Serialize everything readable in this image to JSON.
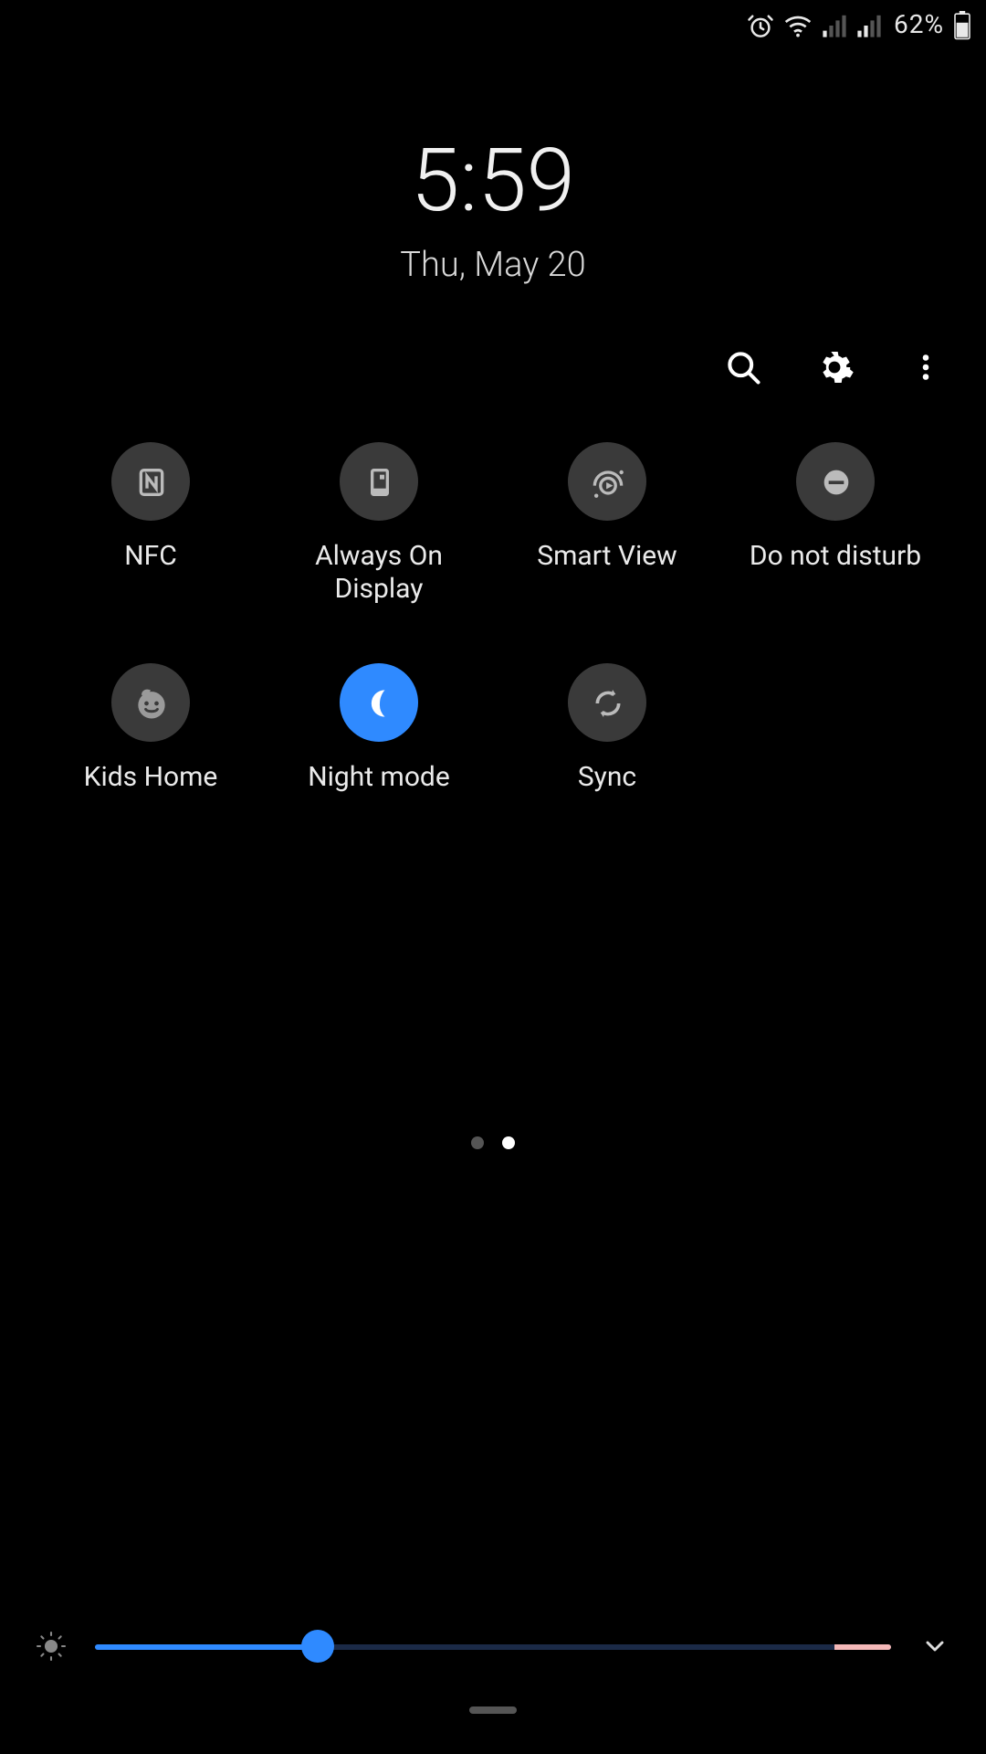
{
  "status": {
    "battery_text": "62%"
  },
  "clock": {
    "time": "5:59",
    "date": "Thu, May 20"
  },
  "tiles": [
    {
      "id": "nfc",
      "label": "NFC",
      "active": false
    },
    {
      "id": "aod",
      "label": "Always On Display",
      "active": false
    },
    {
      "id": "smartview",
      "label": "Smart View",
      "active": false
    },
    {
      "id": "dnd",
      "label": "Do not disturb",
      "active": false
    },
    {
      "id": "kidshome",
      "label": "Kids Home",
      "active": false
    },
    {
      "id": "nightmode",
      "label": "Night mode",
      "active": true
    },
    {
      "id": "sync",
      "label": "Sync",
      "active": false
    }
  ],
  "pagination": {
    "count": 2,
    "active": 1
  },
  "brightness": {
    "percent": 28,
    "auto_zone_percent": 7
  }
}
